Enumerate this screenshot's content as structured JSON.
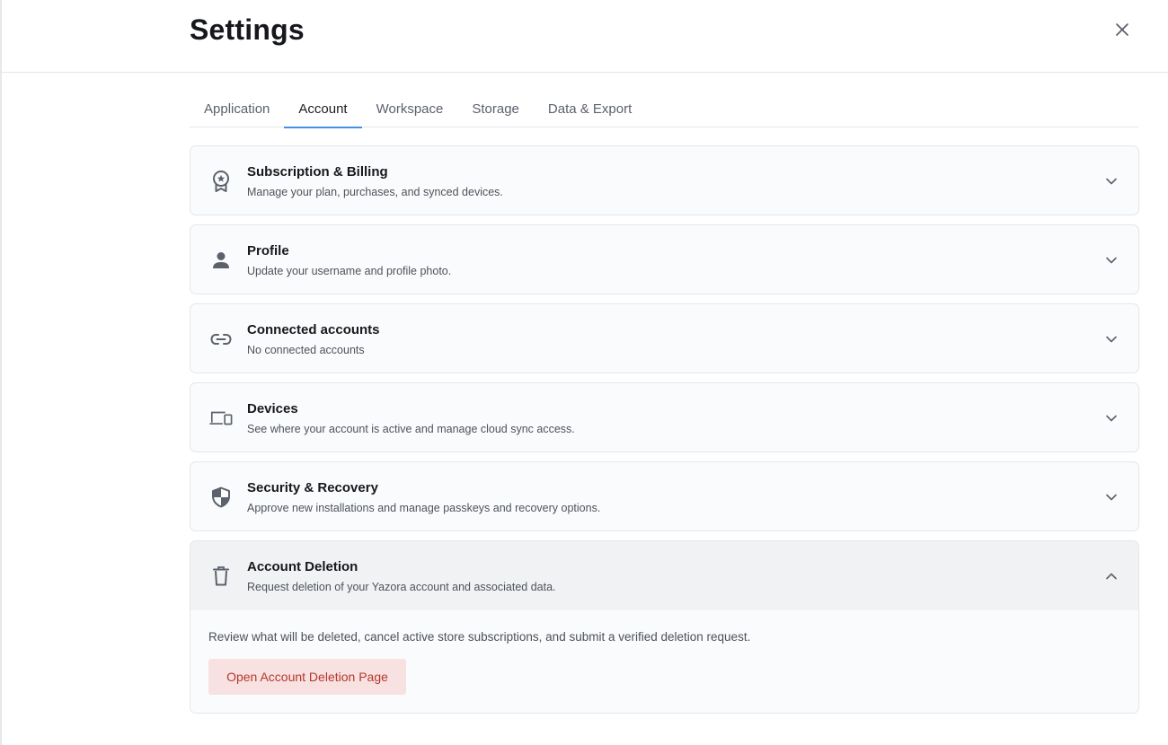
{
  "header": {
    "title": "Settings",
    "close_icon": "close-icon"
  },
  "tabs": [
    {
      "label": "Application",
      "active": false
    },
    {
      "label": "Account",
      "active": true
    },
    {
      "label": "Workspace",
      "active": false
    },
    {
      "label": "Storage",
      "active": false
    },
    {
      "label": "Data & Export",
      "active": false
    }
  ],
  "sections": [
    {
      "icon": "award-badge-icon",
      "title": "Subscription & Billing",
      "desc": "Manage your plan, purchases, and synced devices.",
      "expanded": false
    },
    {
      "icon": "person-icon",
      "title": "Profile",
      "desc": "Update your username and profile photo.",
      "expanded": false
    },
    {
      "icon": "link-icon",
      "title": "Connected accounts",
      "desc": "No connected accounts",
      "expanded": false
    },
    {
      "icon": "devices-icon",
      "title": "Devices",
      "desc": "See where your account is active and manage cloud sync access.",
      "expanded": false
    },
    {
      "icon": "shield-icon",
      "title": "Security & Recovery",
      "desc": "Approve new installations and manage passkeys and recovery options.",
      "expanded": false
    },
    {
      "icon": "trash-icon",
      "title": "Account Deletion",
      "desc": "Request deletion of your Yazora account and associated data.",
      "expanded": true,
      "body": "Review what will be deleted, cancel active store subscriptions, and submit a verified deletion request.",
      "button": "Open Account Deletion Page"
    }
  ],
  "colors": {
    "accent": "#4a90e2",
    "danger_text": "#b5372f",
    "danger_bg": "#f8e1e1"
  }
}
